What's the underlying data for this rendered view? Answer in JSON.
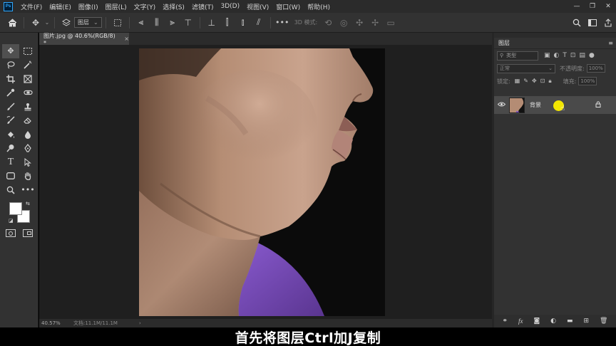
{
  "app": {
    "logo_text": "Ps"
  },
  "menubar": {
    "items": [
      "文件(F)",
      "编辑(E)",
      "图像(I)",
      "图层(L)",
      "文字(Y)",
      "选择(S)",
      "滤镜(T)",
      "3D(D)",
      "视图(V)",
      "窗口(W)",
      "帮助(H)"
    ],
    "window_controls": [
      "—",
      "❐",
      "✕"
    ]
  },
  "options_bar": {
    "auto_select_target": "图层",
    "mode_3d_label": "3D 模式:"
  },
  "document": {
    "tab_title": "图片.jpg @ 40.6%(RGB/8) *",
    "close_glyph": "×",
    "zoom": "40.57%",
    "doc_info": "文档:11.1M/11.1M",
    "status_arrow": "›"
  },
  "layers_panel": {
    "title": "图层",
    "kind_filter": "类型",
    "blend_mode": "正常",
    "opacity_label": "不透明度:",
    "opacity_value": "100%",
    "lock_label": "锁定:",
    "fill_label": "填充:",
    "fill_value": "100%",
    "layers": [
      {
        "name": "背景",
        "visible": true,
        "locked": true
      }
    ]
  },
  "subtitle": "首先将图层Ctrl加J复制",
  "colors": {
    "foreground": "#ffffff",
    "background": "#ffffff",
    "accent_ps": "#31a8ff",
    "cursor_highlight": "#f2e600",
    "shirt": "#7b4fc0"
  },
  "icons": {
    "toolbar": [
      "move-icon",
      "marquee-icon",
      "lasso-icon",
      "magic-wand-icon",
      "crop-icon",
      "frame-icon",
      "eyedropper-icon",
      "spot-healing-icon",
      "brush-icon",
      "stamp-icon",
      "history-brush-icon",
      "eraser-icon",
      "paint-bucket-icon",
      "blur-icon",
      "dodge-icon",
      "pen-icon",
      "type-icon",
      "path-select-icon",
      "shape-icon",
      "hand-icon",
      "zoom-icon",
      "more-tools-icon"
    ]
  }
}
